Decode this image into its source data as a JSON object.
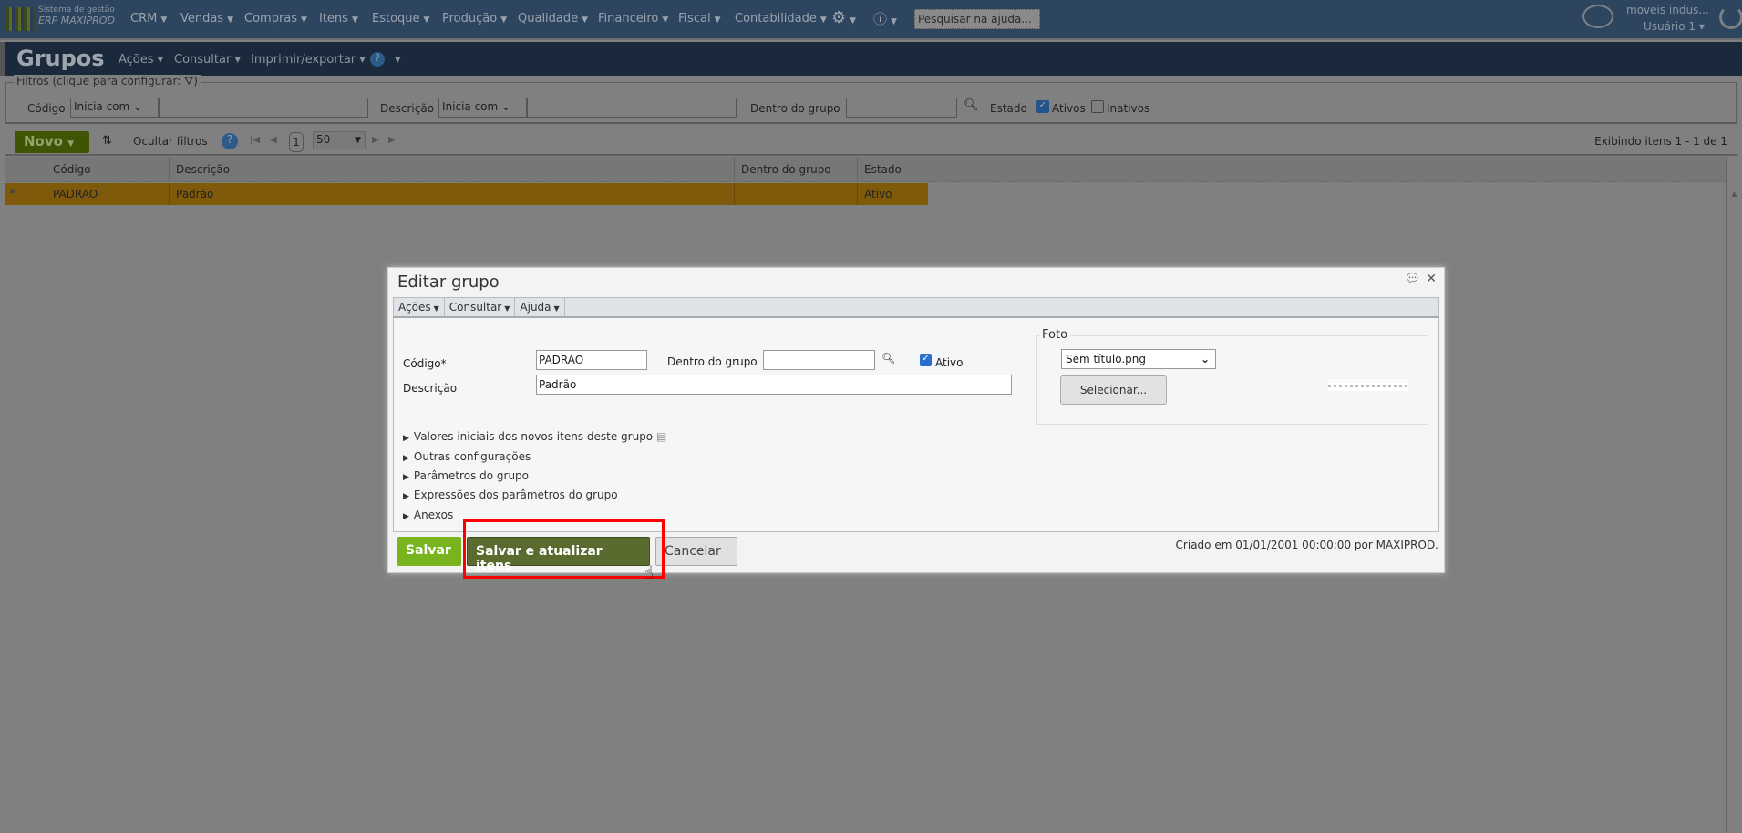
{
  "topbar": {
    "logo_line1": "Sistema de gestão",
    "logo_line2": "ERP MAXIPROD",
    "menu": [
      "CRM",
      "Vendas",
      "Compras",
      "Itens",
      "Estoque",
      "Produção",
      "Qualidade",
      "Financeiro",
      "Fiscal",
      "Contabilidade"
    ],
    "search_placeholder": "Pesquisar na ajuda...",
    "company": "moveis indus...",
    "user": "Usuário 1"
  },
  "page": {
    "title": "Grupos",
    "menu": [
      "Ações",
      "Consultar",
      "Imprimir/exportar"
    ]
  },
  "filters": {
    "legend": "Filtros (clique para configurar:",
    "codigo_label": "Código",
    "codigo_op": "Inicia com",
    "descricao_label": "Descrição",
    "descricao_op": "Inicia com",
    "grupo_label": "Dentro do grupo",
    "estado_label": "Estado",
    "ativos_label": "Ativos",
    "ativos_checked": true,
    "inativos_label": "Inativos",
    "inativos_checked": false
  },
  "toolbar": {
    "novo": "Novo",
    "hide_filters": "Ocultar filtros",
    "page": "1",
    "page_size": "50",
    "status": "Exibindo itens 1 - 1 de 1"
  },
  "table": {
    "headers": [
      "Código",
      "Descrição",
      "Dentro do grupo",
      "Estado"
    ],
    "rows": [
      {
        "codigo": "PADRAO",
        "descricao": "Padrão",
        "grupo": "",
        "estado": "Ativo"
      }
    ]
  },
  "dialog": {
    "title": "Editar grupo",
    "menu": [
      "Ações",
      "Consultar",
      "Ajuda"
    ],
    "codigo_label": "Código*",
    "codigo_value": "PADRAO",
    "grupo_label": "Dentro do grupo",
    "grupo_value": "",
    "ativo_label": "Ativo",
    "ativo_checked": true,
    "descricao_label": "Descrição",
    "descricao_value": "Padrão",
    "foto_legend": "Foto",
    "foto_file": "Sem título.png",
    "select_button": "Selecionar...",
    "sections": [
      "Valores iniciais dos novos itens deste grupo",
      "Outras configurações",
      "Parâmetros do grupo",
      "Expressões dos parâmetros do grupo",
      "Anexos"
    ],
    "save": "Salvar",
    "save_update": "Salvar e atualizar itens",
    "cancel": "Cancelar",
    "created": "Criado em 01/01/2001 00:00:00 por MAXIPROD."
  },
  "colors": {
    "highlight": "#ff0000",
    "save": "#78b41e",
    "save_update": "#5a6b2f"
  }
}
